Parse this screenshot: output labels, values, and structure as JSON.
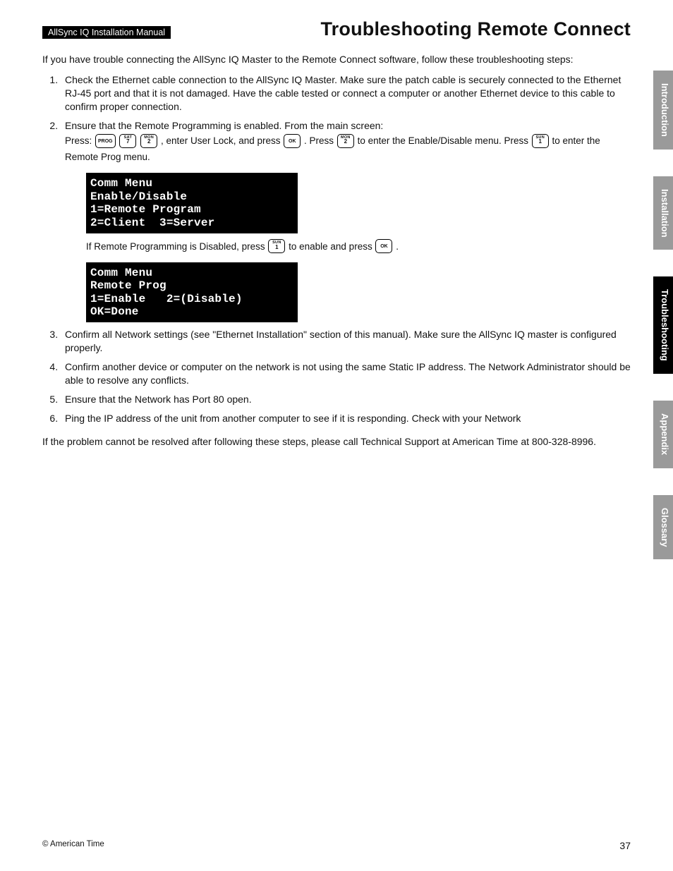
{
  "header": {
    "manual_tag": "AllSync IQ Installation Manual",
    "title": "Troubleshooting Remote Connect"
  },
  "intro": "If you have trouble connecting the AllSync IQ Master to the Remote Connect software, follow these troubleshooting steps:",
  "steps": {
    "s1": "Check the Ethernet cable connection to the AllSync IQ Master. Make sure the patch cable is securely connected to the Ethernet RJ-45 port and that it is not damaged. Have the cable tested or connect a computer or another Ethernet device to this cable to confirm proper connection.",
    "s2_lead": "Ensure that the Remote Programming is enabled. From the main screen:",
    "s2_press_a": "Press: ",
    "s2_press_b": ",  enter User Lock, and press ",
    "s2_press_c": ". Press ",
    "s2_press_d": " to enter the Enable/Disable menu. Press ",
    "s2_press_e": " to enter the Remote Prog menu.",
    "s3": "Confirm all Network settings (see \"Ethernet Installation\" section of this manual). Make sure the AllSync IQ master is configured properly.",
    "s4": "Confirm another device or computer on the network is not using the same Static IP address. The Network Administrator should be able to resolve any conflicts.",
    "s5": "Ensure that the Network has Port 80 open.",
    "s6": "Ping the IP address of the unit from another computer to see if it is responding. Check with your Network"
  },
  "buttons": {
    "prog": "PROG",
    "sat_t": "SAT",
    "sat_n": "7",
    "mon_t": "MON",
    "mon_n": "2",
    "ok": "OK",
    "sun_t": "SUN",
    "sun_n": "1"
  },
  "screen1": {
    "l1": "Comm Menu",
    "l2": "Enable/Disable",
    "l3": "1=Remote Program",
    "l4": "2=Client  3=Server"
  },
  "sub_note_a": "If Remote Programming is Disabled, press ",
  "sub_note_b": " to enable and press ",
  "sub_note_c": ".",
  "screen2": {
    "l1": "Comm Menu",
    "l2": "Remote Prog",
    "l3": "1=Enable   2=(Disable)",
    "l4": "OK=Done"
  },
  "closing": "If the problem cannot be resolved after following these steps, please call Technical Support at American Time at 800-328-8996.",
  "tabs": {
    "t1": "Introduction",
    "t2": "Installation",
    "t3": "Troubleshooting",
    "t4": "Appendix",
    "t5": "Glossary"
  },
  "footer": {
    "copyright": "© American Time",
    "page": "37"
  }
}
